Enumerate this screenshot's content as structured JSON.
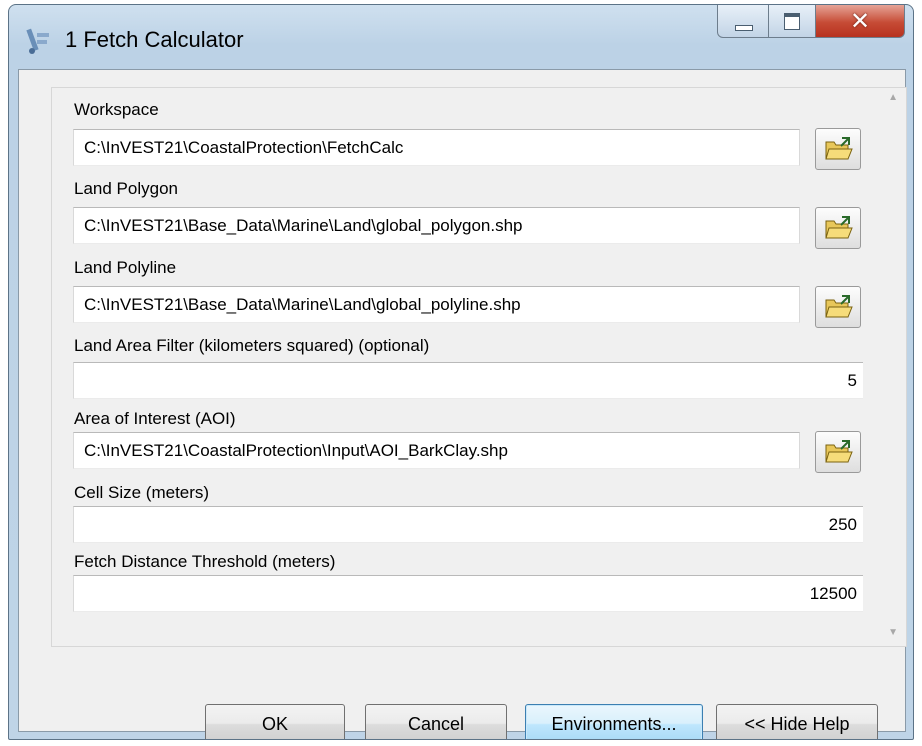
{
  "window": {
    "title": "1 Fetch Calculator"
  },
  "fields": {
    "workspace": {
      "label": "Workspace",
      "value": "C:\\InVEST21\\CoastalProtection\\FetchCalc"
    },
    "land_polygon": {
      "label": "Land Polygon",
      "value": "C:\\InVEST21\\Base_Data\\Marine\\Land\\global_polygon.shp"
    },
    "land_polyline": {
      "label": "Land Polyline",
      "value": "C:\\InVEST21\\Base_Data\\Marine\\Land\\global_polyline.shp"
    },
    "land_area_filter": {
      "label": "Land Area Filter (kilometers squared) (optional)",
      "value": "5"
    },
    "aoi": {
      "label": "Area of Interest (AOI)",
      "value": "C:\\InVEST21\\CoastalProtection\\Input\\AOI_BarkClay.shp"
    },
    "cell_size": {
      "label": "Cell Size (meters)",
      "value": "250"
    },
    "fetch_distance": {
      "label": "Fetch Distance Threshold (meters)",
      "value": "12500"
    }
  },
  "buttons": {
    "ok": "OK",
    "cancel": "Cancel",
    "environments": "Environments...",
    "hide_help": "<< Hide Help"
  },
  "icons": {
    "app": "tool-icon",
    "browse": "open-folder-icon",
    "minimize": "minimize-icon",
    "maximize": "maximize-icon",
    "close": "close-icon"
  },
  "colors": {
    "close_button": "#c64b35",
    "title_bar": "#bcd2e6",
    "dialog_background": "#f0f0f0",
    "focused_button": "#bee6fd"
  }
}
